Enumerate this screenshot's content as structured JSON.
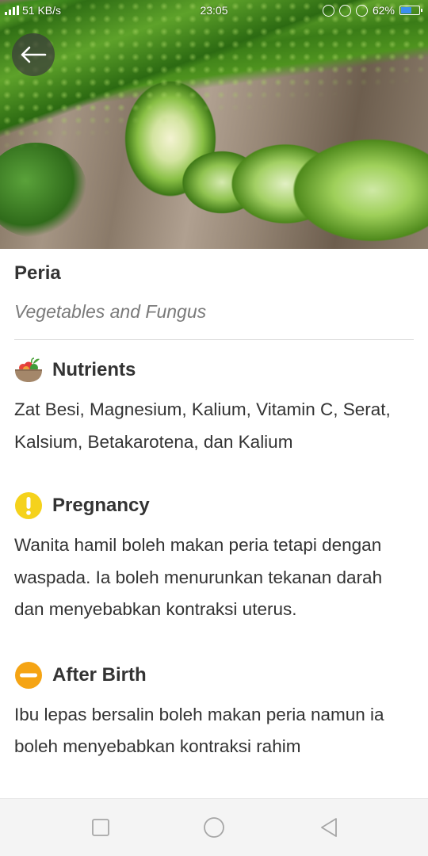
{
  "status_bar": {
    "network_speed": "51 KB/s",
    "time": "23:05",
    "battery": "62%",
    "battery_level": 0.62
  },
  "hero": {
    "image_icon": "bitter-melon-photo"
  },
  "header": {
    "back_icon": "arrow-left-icon"
  },
  "food": {
    "name": "Peria",
    "category": "Vegetables and Fungus"
  },
  "sections": {
    "nutrients": {
      "title": "Nutrients",
      "icon": "food-bowl-icon",
      "text": "Zat Besi, Magnesium, Kalium, Vitamin C, Serat, Kalsium, Betakarotena, dan Kalium"
    },
    "pregnancy": {
      "title": "Pregnancy",
      "icon": "warning-icon",
      "color": "#f5d21c",
      "text": "Wanita hamil boleh makan peria tetapi dengan waspada. Ia boleh menurunkan tekanan darah dan menyebabkan kontraksi uterus."
    },
    "after_birth": {
      "title": "After Birth",
      "icon": "minus-circle-icon",
      "color": "#f5a414",
      "text": "Ibu lepas bersalin boleh makan peria namun ia boleh menyebabkan kontraksi rahim"
    }
  },
  "nav_bar": {
    "recents_icon": "square-icon",
    "home_icon": "circle-icon",
    "back_icon": "triangle-back-icon"
  }
}
